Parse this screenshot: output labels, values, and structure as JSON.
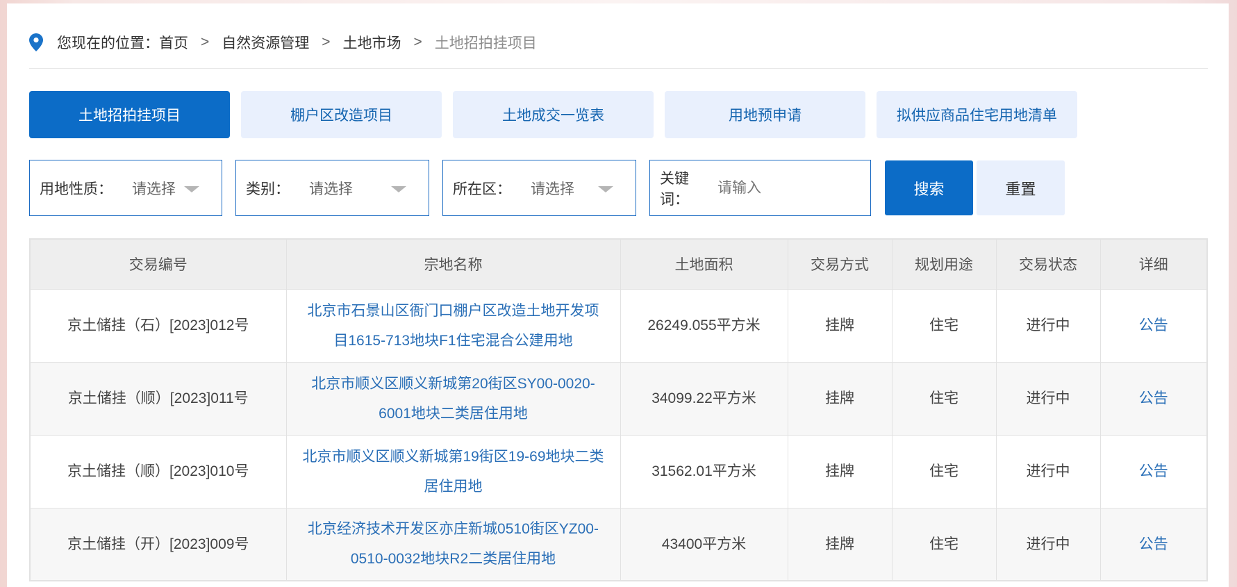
{
  "breadcrumb": {
    "prefix": "您现在的位置：",
    "items": [
      "首页",
      "自然资源管理",
      "土地市场",
      "土地招拍挂项目"
    ],
    "separator": ">"
  },
  "tabs": [
    {
      "label": "土地招拍挂项目",
      "active": true
    },
    {
      "label": "棚户区改造项目",
      "active": false
    },
    {
      "label": "土地成交一览表",
      "active": false
    },
    {
      "label": "用地预申请",
      "active": false
    },
    {
      "label": "拟供应商品住宅用地清单",
      "active": false
    }
  ],
  "filters": {
    "land_nature": {
      "label": "用地性质：",
      "value": "请选择"
    },
    "category": {
      "label": "类别：",
      "value": "请选择"
    },
    "district": {
      "label": "所在区：",
      "value": "请选择"
    },
    "keyword": {
      "label": "关键词：",
      "placeholder": "请输入"
    },
    "search_label": "搜索",
    "reset_label": "重置"
  },
  "table": {
    "headers": [
      "交易编号",
      "宗地名称",
      "土地面积",
      "交易方式",
      "规划用途",
      "交易状态",
      "详细"
    ],
    "rows": [
      {
        "code": "京土储挂（石）[2023]012号",
        "name": "北京市石景山区衙门口棚户区改造土地开发项目1615-713地块F1住宅混合公建用地",
        "area": "26249.055平方米",
        "method": "挂牌",
        "usage": "住宅",
        "status": "进行中",
        "detail": "公告"
      },
      {
        "code": "京土储挂（顺）[2023]011号",
        "name": "北京市顺义区顺义新城第20街区SY00-0020-6001地块二类居住用地",
        "area": "34099.22平方米",
        "method": "挂牌",
        "usage": "住宅",
        "status": "进行中",
        "detail": "公告"
      },
      {
        "code": "京土储挂（顺）[2023]010号",
        "name": "北京市顺义区顺义新城第19街区19-69地块二类居住用地",
        "area": "31562.01平方米",
        "method": "挂牌",
        "usage": "住宅",
        "status": "进行中",
        "detail": "公告"
      },
      {
        "code": "京土储挂（开）[2023]009号",
        "name": "北京经济技术开发区亦庄新城0510街区YZ00-0510-0032地块R2二类居住用地",
        "area": "43400平方米",
        "method": "挂牌",
        "usage": "住宅",
        "status": "进行中",
        "detail": "公告"
      }
    ]
  },
  "colors": {
    "accent": "#0c6cc7",
    "tab_bg": "#e9f0fd",
    "link": "#2a6fb7"
  }
}
